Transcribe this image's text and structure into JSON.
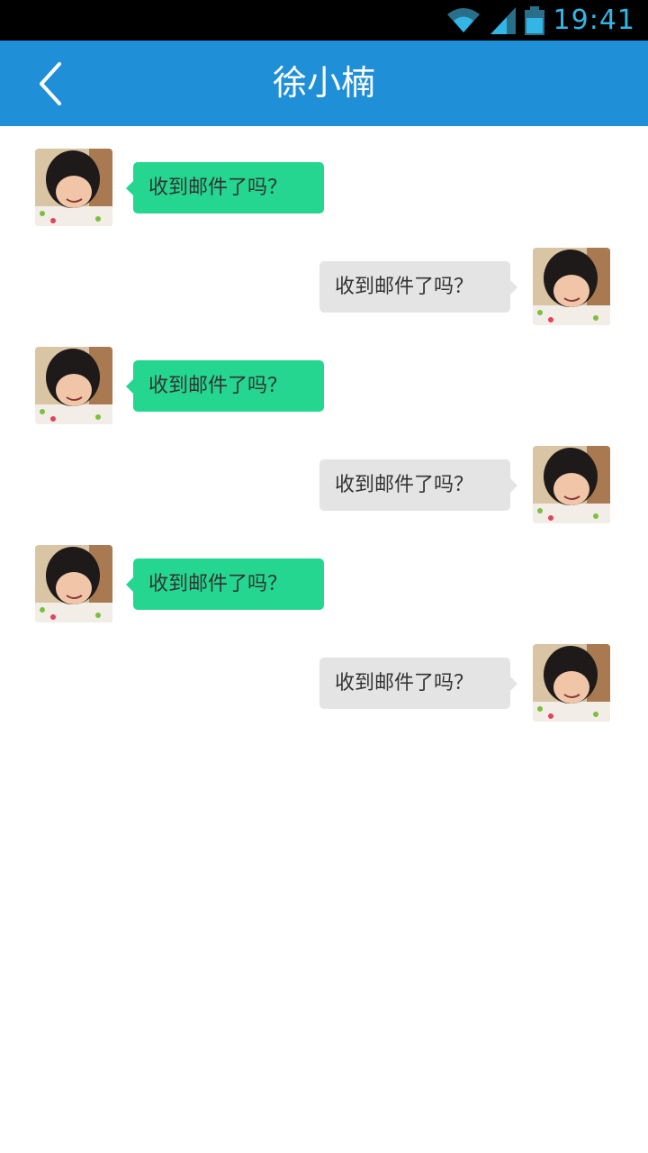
{
  "status_bar": {
    "time": "19:41",
    "icons": [
      "wifi-icon",
      "signal-icon",
      "battery-icon"
    ]
  },
  "header": {
    "title": "徐小楠",
    "back_icon": "chevron-left-icon"
  },
  "colors": {
    "header": "#1f8fd8",
    "incoming_bubble": "#24d68f",
    "outgoing_bubble": "#e4e4e4",
    "status_time": "#33b5e5"
  },
  "messages": [
    {
      "side": "left",
      "text": "收到邮件了吗？"
    },
    {
      "side": "right",
      "text": "收到邮件了吗？"
    },
    {
      "side": "left",
      "text": "收到邮件了吗？"
    },
    {
      "side": "right",
      "text": "收到邮件了吗？"
    },
    {
      "side": "left",
      "text": "收到邮件了吗？"
    },
    {
      "side": "right",
      "text": "收到邮件了吗？"
    }
  ]
}
